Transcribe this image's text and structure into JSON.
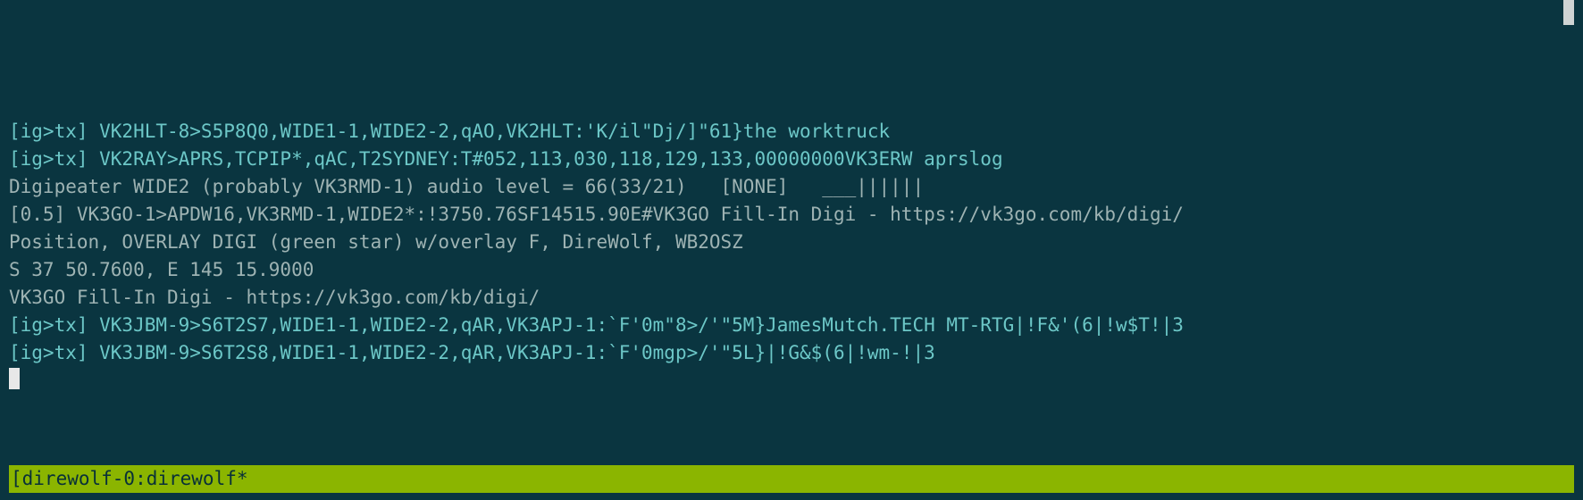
{
  "terminal": {
    "lines": [
      {
        "cls": "fg-teal",
        "text": "[ig>tx] VK2HLT-8>S5P8Q0,WIDE1-1,WIDE2-2,qAO,VK2HLT:'K/il\"Dj/]\"61}the worktruck"
      },
      {
        "cls": "",
        "text": ""
      },
      {
        "cls": "fg-teal",
        "text": "[ig>tx] VK2RAY>APRS,TCPIP*,qAC,T2SYDNEY:T#052,113,030,118,129,133,00000000VK3ERW aprslog"
      },
      {
        "cls": "",
        "text": ""
      },
      {
        "cls": "fg-dim",
        "text": "Digipeater WIDE2 (probably VK3RMD-1) audio level = 66(33/21)   [NONE]   ___||||||"
      },
      {
        "cls": "fg-dim",
        "text": "[0.5] VK3GO-1>APDW16,VK3RMD-1,WIDE2*:!3750.76SF14515.90E#VK3GO Fill-In Digi - https://vk3go.com/kb/digi/"
      },
      {
        "cls": "fg-dim",
        "text": "Position, OVERLAY DIGI (green star) w/overlay F, DireWolf, WB2OSZ"
      },
      {
        "cls": "fg-dim",
        "text": "S 37 50.7600, E 145 15.9000"
      },
      {
        "cls": "fg-dim",
        "text": "VK3GO Fill-In Digi - https://vk3go.com/kb/digi/"
      },
      {
        "cls": "",
        "text": ""
      },
      {
        "cls": "fg-teal",
        "text": "[ig>tx] VK3JBM-9>S6T2S7,WIDE1-1,WIDE2-2,qAR,VK3APJ-1:`F'0m\"8>/'\"5M}JamesMutch.TECH MT-RTG|!F&'(6|!w$T!|3"
      },
      {
        "cls": "",
        "text": ""
      },
      {
        "cls": "fg-teal",
        "text": "[ig>tx] VK3JBM-9>S6T2S8,WIDE1-1,WIDE2-2,qAR,VK3APJ-1:`F'0mgp>/'\"5L}|!G&$(6|!wm-!|3"
      }
    ],
    "statusbar_text": "[direwolf-0:direwolf*"
  }
}
